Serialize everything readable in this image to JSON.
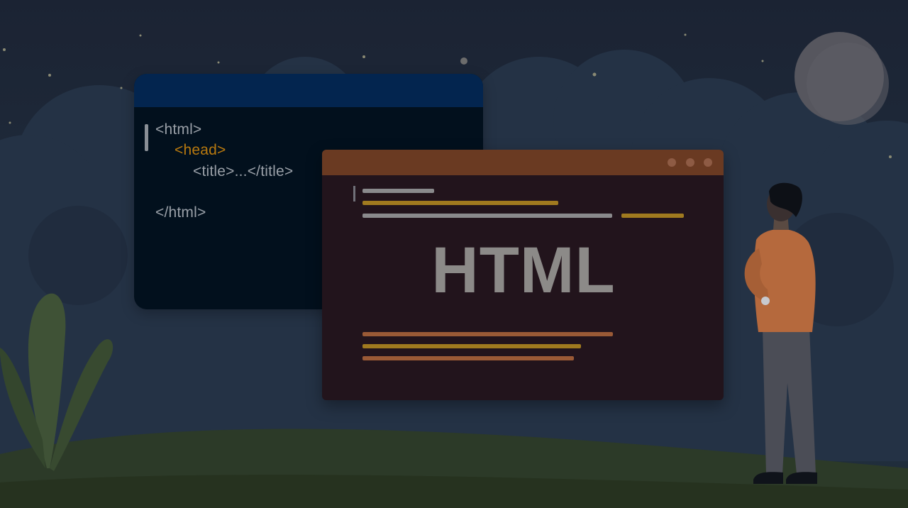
{
  "code_window": {
    "lines": [
      "<html>",
      "<head>",
      "<title>...</title>",
      "</html>"
    ]
  },
  "html_window": {
    "title_word": "HTML"
  },
  "colors": {
    "sky": "#1b2333",
    "cloud": "#243245",
    "moon": "#5e5e66",
    "code_window_bg": "#02101d",
    "code_window_bar": "#03254f",
    "code_text": "#9aa0a8",
    "code_tag_accent": "#b8790f",
    "html_window_bg": "#22141c",
    "html_window_bar": "#6a3a22",
    "html_word": "#8c8a88",
    "bar_gray": "#8a8a8c",
    "bar_gold": "#a07a1f",
    "bar_copper": "#9a5a36",
    "hill": "#2c3a28",
    "plant": "#3f5236",
    "person_shirt": "#b5693d",
    "person_pants": "#4b4d56",
    "person_hair": "#0d1016"
  }
}
